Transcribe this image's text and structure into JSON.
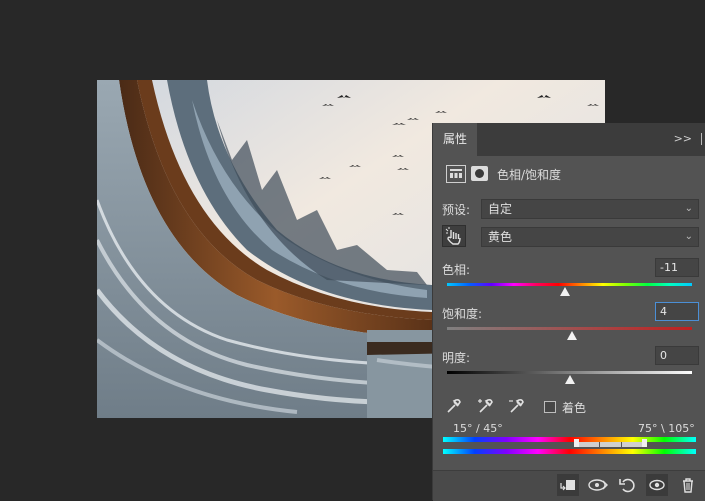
{
  "panel": {
    "tab_label": "属性",
    "collapse_glyph": ">>",
    "header_title": "色相/饱和度",
    "preset_label": "预设:",
    "preset_value": "自定",
    "channel_value": "黄色",
    "hue": {
      "label": "色相:",
      "value": "-11",
      "level": 0.48
    },
    "saturation": {
      "label": "饱和度:",
      "value": "4",
      "level": 0.51
    },
    "lightness": {
      "label": "明度:",
      "value": "0",
      "level": 0.5
    },
    "colorize_label": "着色",
    "range_left": "15° / 45°",
    "range_right": "75° \\ 105°"
  },
  "colors": {
    "panel_bg": "#535353",
    "field_bg": "#454545",
    "active_border": "#4b8fd6"
  },
  "icons": [
    "adjustment-icon",
    "mask-icon",
    "target-hand-icon",
    "eyedropper-icon",
    "eyedropper-plus-icon",
    "eyedropper-minus-icon",
    "clip-to-layer-icon",
    "view-previous-icon",
    "reset-icon",
    "visibility-icon",
    "trash-icon"
  ]
}
